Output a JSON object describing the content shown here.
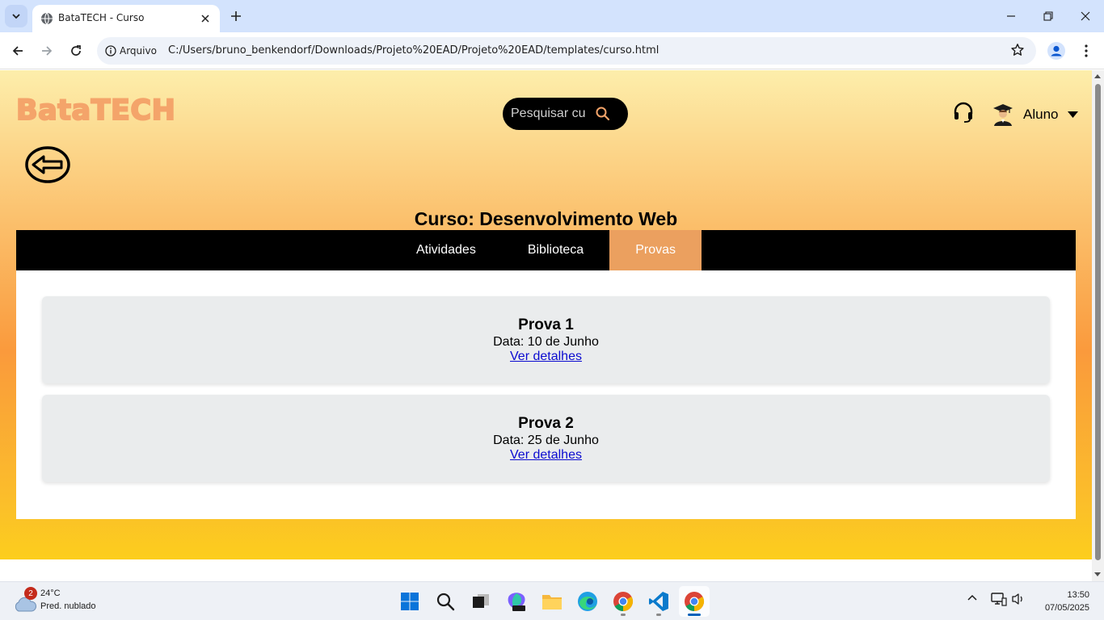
{
  "browser": {
    "tab_title": "BataTECH - Curso",
    "security_chip": "Arquivo",
    "url": "C:/Users/bruno_benkendorf/Downloads/Projeto%20EAD/Projeto%20EAD/templates/curso.html"
  },
  "page": {
    "logo": "BataTECH",
    "search": {
      "placeholder": "Pesquisar curso"
    },
    "user": {
      "label": "Aluno"
    },
    "course_title": "Curso: Desenvolvimento Web",
    "nav": [
      {
        "label": "Atividades",
        "active": false
      },
      {
        "label": "Biblioteca",
        "active": false
      },
      {
        "label": "Provas",
        "active": true
      }
    ],
    "exams": [
      {
        "title": "Prova 1",
        "date": "Data: 10 de Junho",
        "link": "Ver detalhes"
      },
      {
        "title": "Prova 2",
        "date": "Data: 25 de Junho",
        "link": "Ver detalhes"
      }
    ],
    "colors": {
      "accent": "#eba05f",
      "logo": "#f4a46a",
      "nav_bg": "#000000"
    }
  },
  "taskbar": {
    "weather": {
      "badge": "2",
      "temp": "24°C",
      "desc": "Pred. nublado"
    },
    "clock": {
      "time": "13:50",
      "date": "07/05/2025"
    },
    "apps": [
      "start-icon",
      "search-icon",
      "task-view-icon",
      "m365-copilot-icon",
      "file-explorer-icon",
      "edge-icon",
      "chrome-icon",
      "vscode-icon",
      "chrome-icon"
    ]
  }
}
